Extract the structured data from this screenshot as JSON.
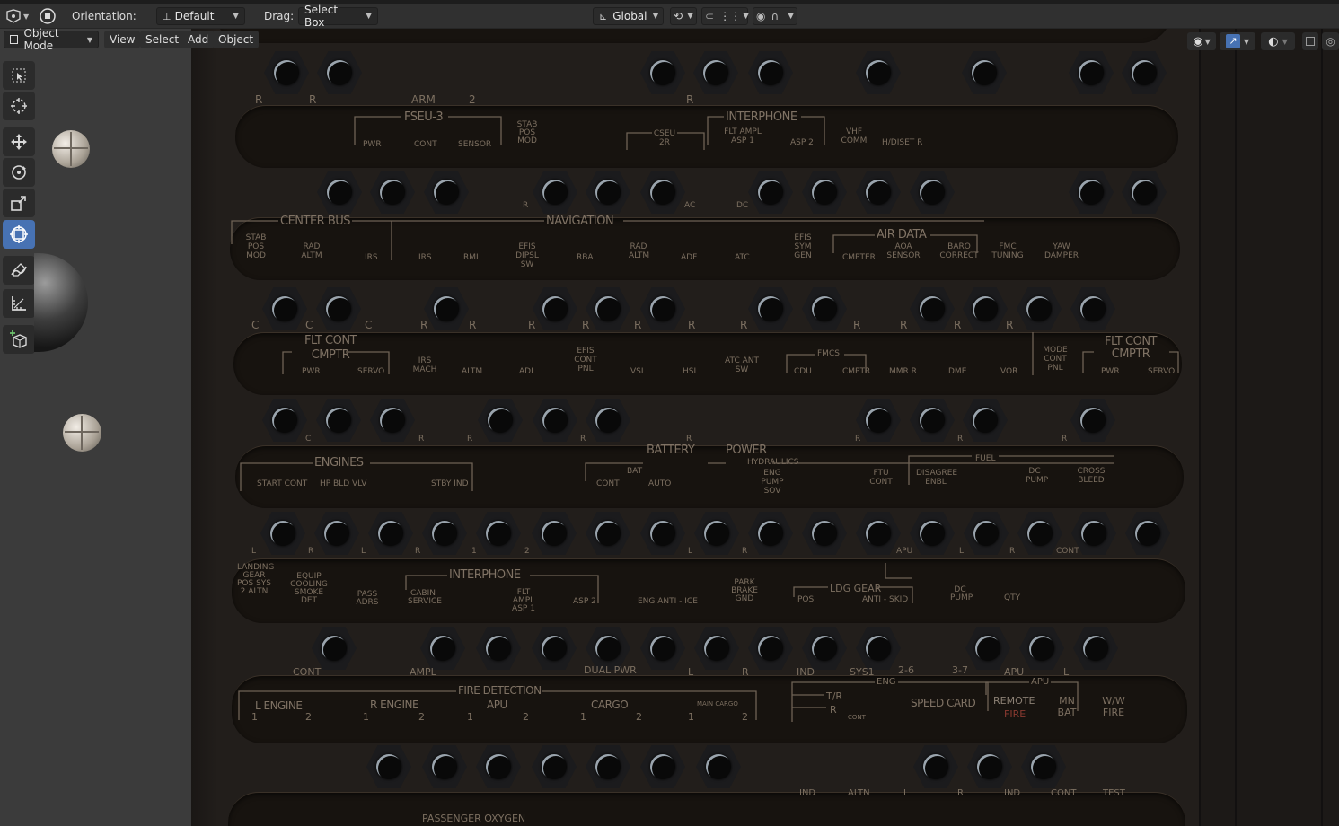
{
  "header": {
    "orientation_label": "Orientation:",
    "orientation_value": "Default",
    "drag_label": "Drag:",
    "drag_value": "Select Box",
    "transform_space": "Global"
  },
  "viewport_header": {
    "mode": "Object Mode",
    "menus": [
      "View",
      "Select",
      "Add",
      "Object"
    ]
  },
  "toolbar": {
    "tools": [
      "select-box",
      "cursor",
      "move",
      "rotate",
      "scale",
      "transform",
      "annotate",
      "measure",
      "add-cube"
    ],
    "active_tool": "transform"
  },
  "colors": {
    "accent": "#4772b3",
    "header_bg": "#303030",
    "panel_bg": "#221e1b",
    "label": "#7c6f60",
    "red_label": "#8a3a30"
  },
  "panel": {
    "row1_labels": [
      "R",
      "R",
      "ARM",
      "2",
      "R"
    ],
    "band1_labels": [
      "FSEU-3",
      "PWR",
      "CONT",
      "SENSOR",
      "STAB POS MOD",
      "CSEU 2R",
      "INTERPHONE",
      "FLT AMPL ASP 1",
      "ASP 2",
      "VHF COMM",
      "H/DISET R"
    ],
    "row2_labels": [
      "R",
      "AC",
      "DC"
    ],
    "band2_labels": [
      "STAB POS MOD",
      "CENTER BUS",
      "RAD ALTM",
      "IRS",
      "NAVIGATION",
      "IRS",
      "RMI",
      "EFIS DIPSL SW",
      "RBA",
      "RAD ALTM",
      "ADF",
      "ATC",
      "EFIS SYM GEN",
      "AIR DATA",
      "CMPTER",
      "AOA SENSOR",
      "BARO CORRECT",
      "FMC TUNING",
      "YAW DAMPER"
    ],
    "row3_labels": [
      "C",
      "C",
      "C",
      "R",
      "R",
      "R",
      "R",
      "R",
      "R",
      "R",
      "R",
      "R",
      "R",
      "R"
    ],
    "band3_labels": [
      "FLT CONT CMPTR",
      "PWR",
      "SERVO",
      "IRS MACH",
      "ALTM",
      "ADI",
      "EFIS CONT PNL",
      "VSI",
      "HSI",
      "ATC ANT SW",
      "FMCS",
      "CDU",
      "CMPTR",
      "MMR R",
      "DME",
      "VOR",
      "MODE CONT PNL",
      "FLT CONT CMPTR",
      "PWR",
      "SERVO"
    ],
    "row4_labels": [
      "C",
      "R",
      "R",
      "R",
      "R",
      "R",
      "R",
      "R"
    ],
    "band4_labels": [
      "BATTERY",
      "POWER",
      "ENGINES",
      "START CONT",
      "HP BLD VLV",
      "STBY IND",
      "BAT",
      "CONT",
      "AUTO",
      "HYDRAULICS",
      "ENG PUMP SOV",
      "FTU CONT",
      "DISAGREE ENBL",
      "FUEL",
      "DC PUMP",
      "CROSS BLEED"
    ],
    "row5_labels": [
      "L",
      "R",
      "L",
      "R",
      "1",
      "2",
      "L",
      "R",
      "APU",
      "L",
      "R",
      "CONT"
    ],
    "band5_labels": [
      "LANDING GEAR POS SYS 2 ALTN",
      "EQUIP COOLING SMOKE DET",
      "PASS ADRS",
      "INTERPHONE",
      "CABIN SERVICE",
      "FLT AMPL ASP 1",
      "ASP 2",
      "ENG ANTI - ICE",
      "PARK BRAKE GND",
      "LDG GEAR",
      "POS",
      "ANTI - SKID",
      "DC PUMP",
      "QTY"
    ],
    "row6_labels": [
      "CONT",
      "AMPL",
      "DUAL PWR",
      "L",
      "R",
      "IND",
      "SYS1",
      "2-6",
      "3-7",
      "APU",
      "L"
    ],
    "band6_labels": [
      "FIRE DETECTION",
      "L ENGINE",
      "1",
      "2",
      "R ENGINE",
      "1",
      "2",
      "APU",
      "1",
      "2",
      "CARGO",
      "1",
      "2",
      "MAIN CARGO",
      "1",
      "2",
      "ENG",
      "T/R",
      "R",
      "CONT",
      "SPEED CARD",
      "APU",
      "REMOTE",
      "FIRE",
      "MN BAT",
      "W/W FIRE"
    ],
    "row7_labels": [
      "IND",
      "ALTN",
      "L",
      "R",
      "IND",
      "CONT",
      "TEST"
    ],
    "band7_labels": [
      "PASSENGER OXYGEN"
    ]
  }
}
